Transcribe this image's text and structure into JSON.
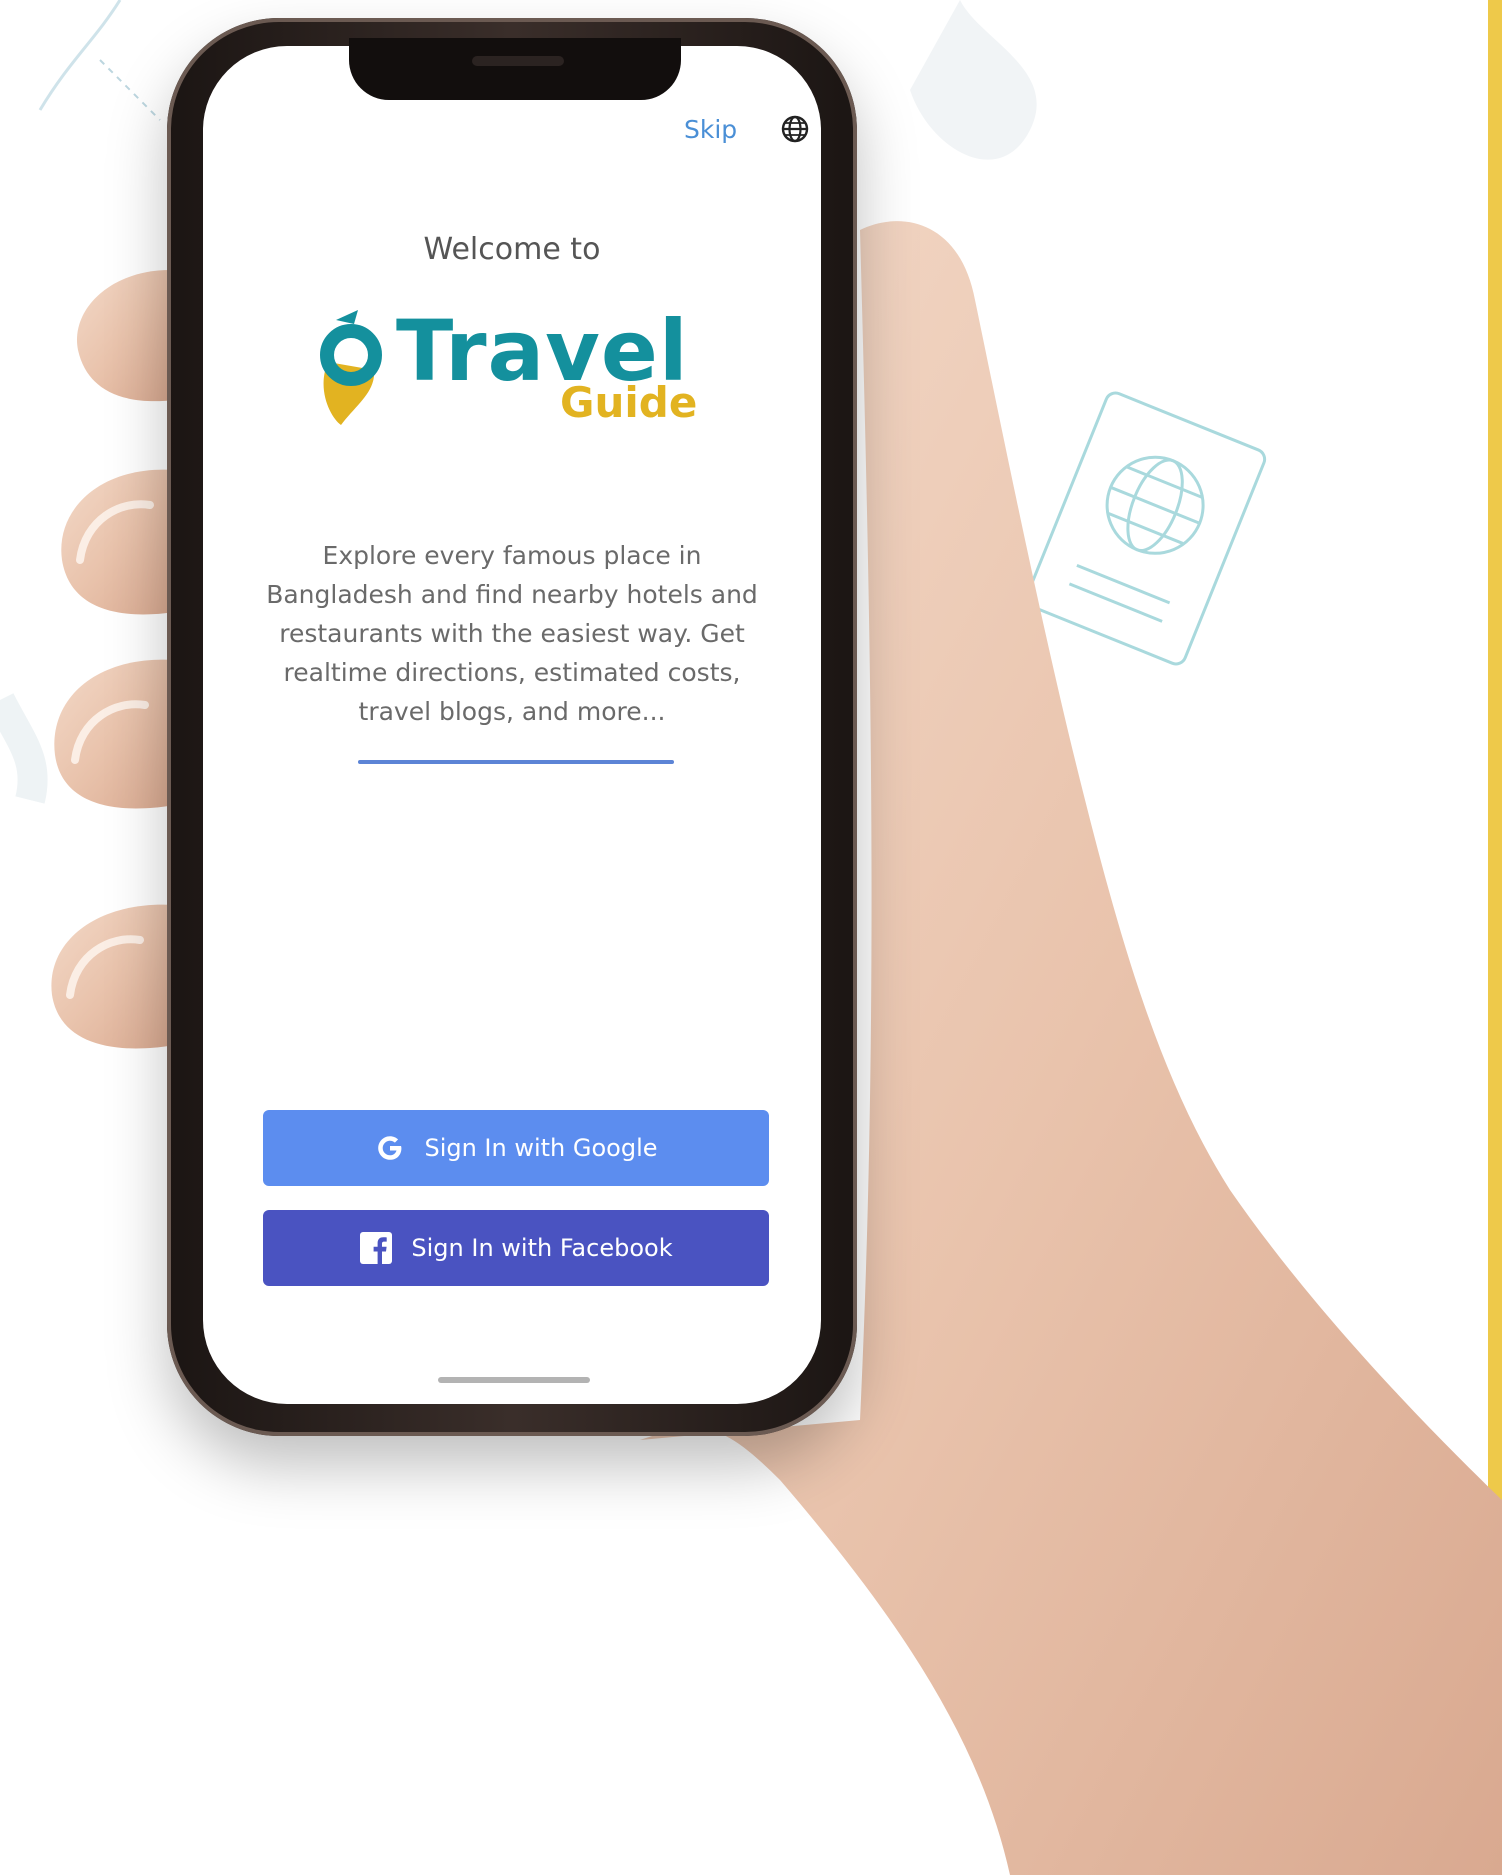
{
  "header": {
    "skip_label": "Skip"
  },
  "welcome": {
    "intro": "Welcome to",
    "logo_title": "Travel",
    "logo_subtitle": "Guide"
  },
  "description": "Explore every famous place in Bangladesh and find nearby hotels and restaurants with the easiest way. Get realtime directions, estimated costs, travel blogs, and more...",
  "buttons": {
    "google_label": "Sign In with Google",
    "facebook_label": "Sign In with Facebook"
  },
  "colors": {
    "google_button": "#5c8def",
    "facebook_button": "#4a53c1",
    "logo_teal": "#14909d",
    "logo_gold": "#e2b321",
    "skip_link": "#4a8fd6",
    "accent_bar": "#eec94a"
  },
  "icons": {
    "language": "globe-icon",
    "google": "google-icon",
    "facebook": "facebook-icon"
  }
}
